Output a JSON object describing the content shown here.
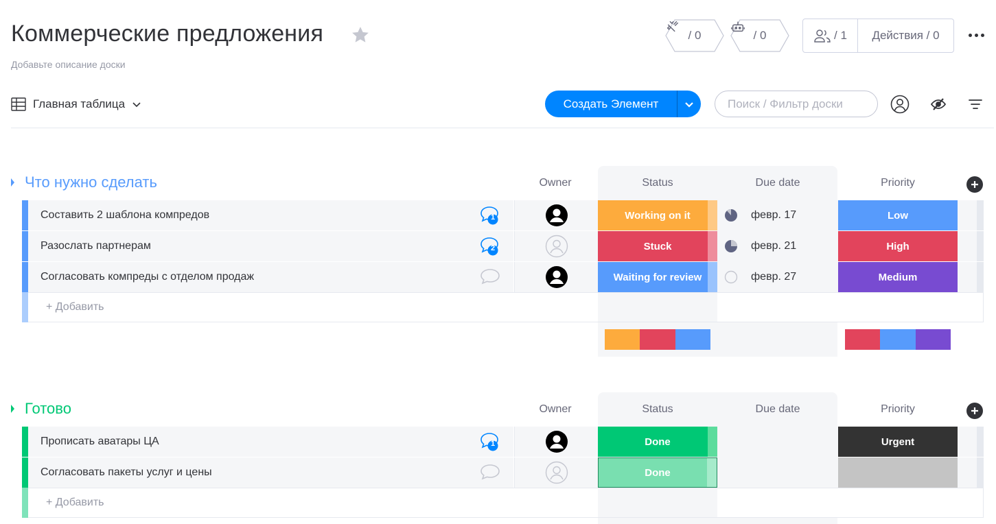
{
  "header": {
    "title": "Коммерческие предложения",
    "description": "Добавьте описание доски",
    "integrations_count": "/ 0",
    "automations_count": "/ 0",
    "members_count": "/ 1",
    "activity_label": "Действия / 0"
  },
  "toolbar": {
    "view_label": "Главная таблица",
    "create_label": "Создать Элемент",
    "search_placeholder": "Поиск / Фильтр доски"
  },
  "columns": {
    "owner": "Owner",
    "status": "Status",
    "due_date": "Due date",
    "priority": "Priority"
  },
  "groups": [
    {
      "title": "Что нужно сделать",
      "color": "#579bfc",
      "add_label": "+ Добавить",
      "rows": [
        {
          "name": "Составить 2 шаблона компредов",
          "comments": "1",
          "owner": "user",
          "status": "Working on it",
          "status_color": "#fdab3d",
          "date": "февр. 17",
          "date_icon": "clock-mostly",
          "priority": "Low",
          "priority_color": "#579bfc"
        },
        {
          "name": "Разослать партнерам",
          "comments": "2",
          "owner": "empty",
          "status": "Stuck",
          "status_color": "#e2445c",
          "date": "февр. 21",
          "date_icon": "clock-quarter",
          "priority": "High",
          "priority_color": "#e2445c"
        },
        {
          "name": "Согласовать компреды с отделом продаж",
          "comments": "",
          "owner": "user",
          "status": "Waiting for review",
          "status_color": "#579bfc",
          "date": "февр. 27",
          "date_icon": "clock-empty",
          "priority": "Medium",
          "priority_color": "#784bd1"
        }
      ],
      "status_summary": [
        "#fdab3d",
        "#e2445c",
        "#579bfc"
      ],
      "priority_summary": [
        "#e2445c",
        "#579bfc",
        "#784bd1"
      ]
    },
    {
      "title": "Готово",
      "color": "#00c875",
      "add_label": "+ Добавить",
      "rows": [
        {
          "name": "Прописать аватары ЦА",
          "comments": "1",
          "owner": "user",
          "status": "Done",
          "status_color": "#00c875",
          "date": "",
          "priority": "Urgent",
          "priority_color": "#333333"
        },
        {
          "name": "Согласовать пакеты услуг и цены",
          "comments": "",
          "owner": "empty",
          "status": "Done",
          "status_color": "#79dfb0",
          "date": "",
          "priority": "",
          "priority_color": "#c4c4c4"
        }
      ]
    }
  ]
}
